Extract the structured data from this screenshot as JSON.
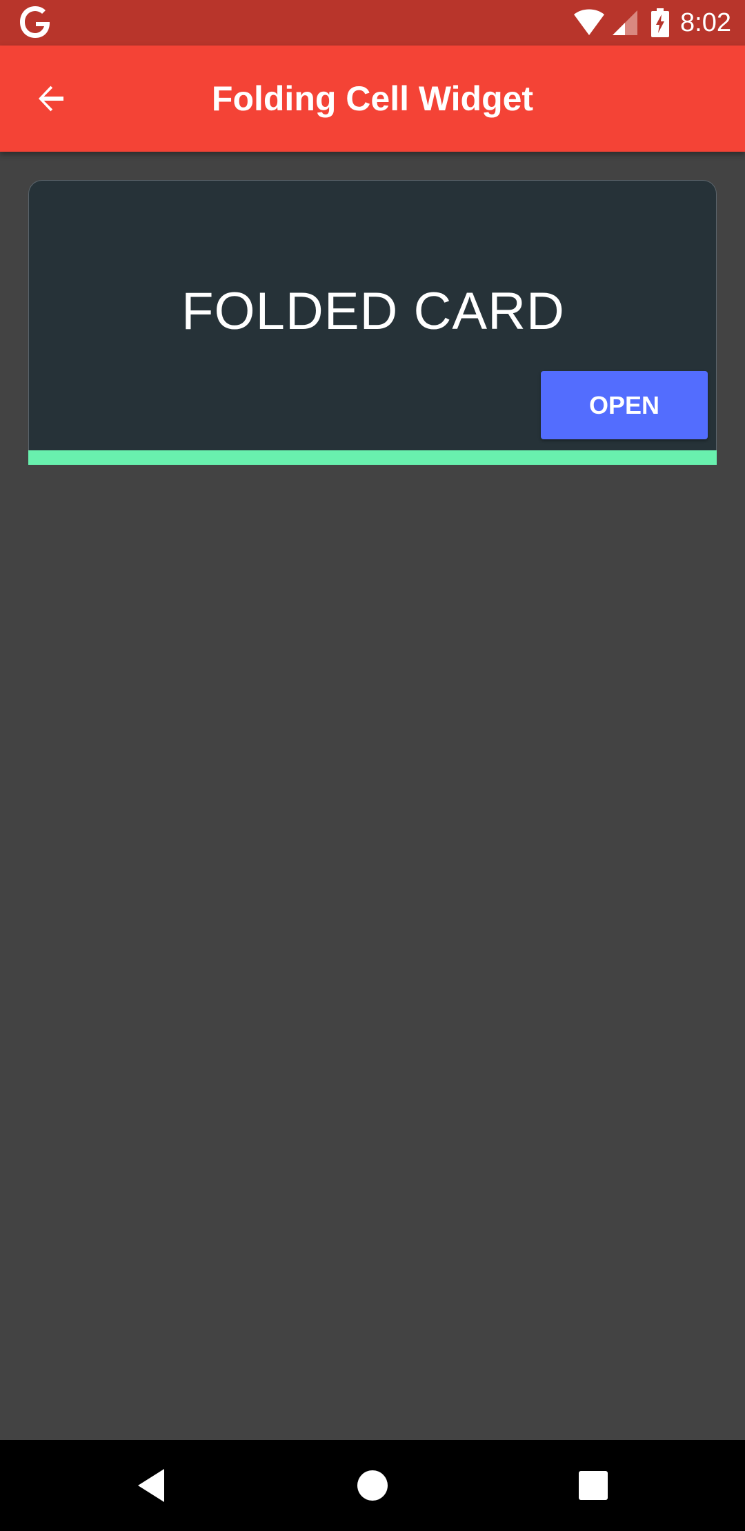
{
  "status_bar": {
    "time": "8:02",
    "left_icon": "google-g-icon",
    "icons": [
      "wifi-icon",
      "signal-icon",
      "battery-charging-icon"
    ]
  },
  "app_bar": {
    "title": "Folding Cell Widget",
    "back_icon": "arrow-back-icon",
    "color": "#f44336"
  },
  "card": {
    "title": "FOLDED CARD",
    "open_label": "OPEN",
    "background": "#263238",
    "button_color": "#536dfe",
    "stripe_color": "#69f0ae"
  },
  "nav_bar": {
    "buttons": [
      "back-triangle-icon",
      "home-circle-icon",
      "recents-square-icon"
    ]
  },
  "colors": {
    "page_background": "#434343",
    "status_bar": "#b8352b"
  }
}
